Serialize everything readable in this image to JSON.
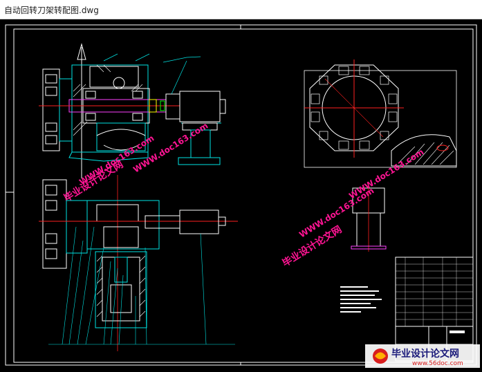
{
  "window": {
    "title": "自动回转刀架转配图.dwg"
  },
  "watermark": {
    "text": "毕业设计论文网",
    "url": "WWW.doc163.com"
  },
  "logo": {
    "text": "毕业设计论文网",
    "url": "www.56doc.com"
  },
  "colors": {
    "background": "#000000",
    "cyan": "#00e5e5",
    "white": "#ffffff",
    "red": "#ff2020",
    "yellow": "#ffff00",
    "magenta": "#ff40ff",
    "green": "#00ff00",
    "watermark": "#ff1493"
  }
}
